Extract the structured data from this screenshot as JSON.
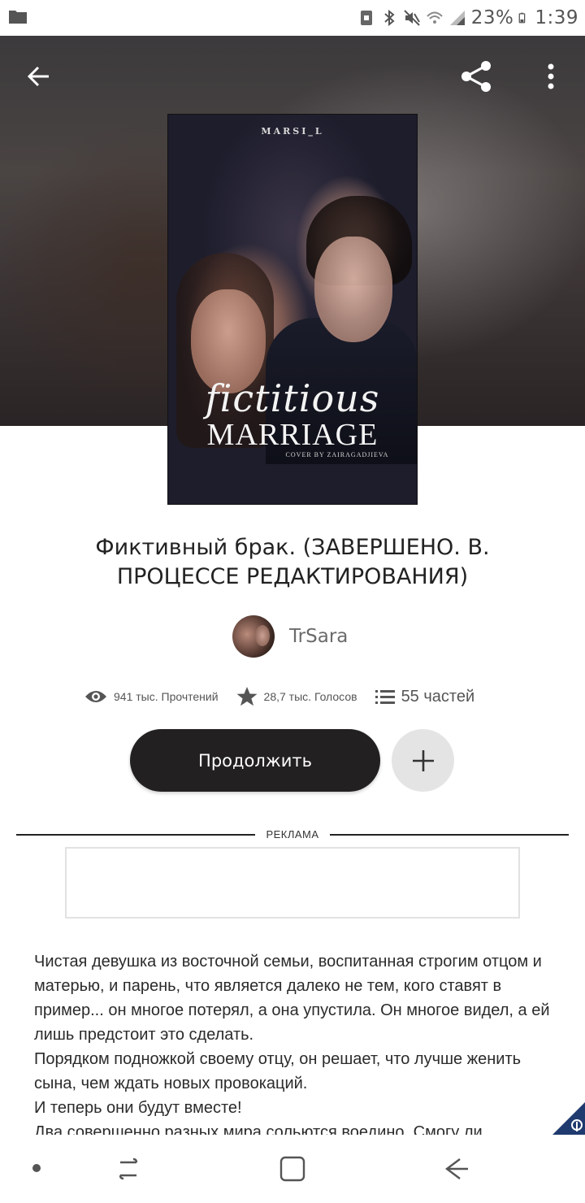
{
  "status_bar": {
    "battery_percent": "23%",
    "time": "1:39"
  },
  "book": {
    "cover": {
      "author_line": "MARSI_L",
      "title_script": "fictitious",
      "title_main": "MARRIAGE",
      "credit": "COVER BY ZAIRAGADJIEVA"
    },
    "title": "Фиктивный брак. (ЗАВЕРШЕНО. В. ПРОЦЕССЕ РЕДАКТИРОВАНИЯ)",
    "author": "TrSara"
  },
  "stats": {
    "reads": "941 тыс. Прочтений",
    "votes": "28,7 тыс. Голосов",
    "parts": "55 частей"
  },
  "actions": {
    "continue_label": "Продолжить"
  },
  "ad": {
    "label": "РЕКЛАМА"
  },
  "description": [
    "Чистая девушка из восточной семьи, воспитанная строгим отцом и матерью, и парень, что является далеко не тем, кого ставят в пример... он многое потерял, а она упустила. Он многое видел, а ей лишь предстоит это сделать.",
    "Порядком подножкой своему отцу, он решает, что лучше женить сына, чем ждать новых провокаций.",
    "И теперь они будут вместе!",
    "Два совершенно разных мира сольются воедино. Смогу ли"
  ],
  "colors": {
    "continue_button": "#222021",
    "add_button": "#e5e4e5",
    "badge": "#1f3a6e"
  }
}
